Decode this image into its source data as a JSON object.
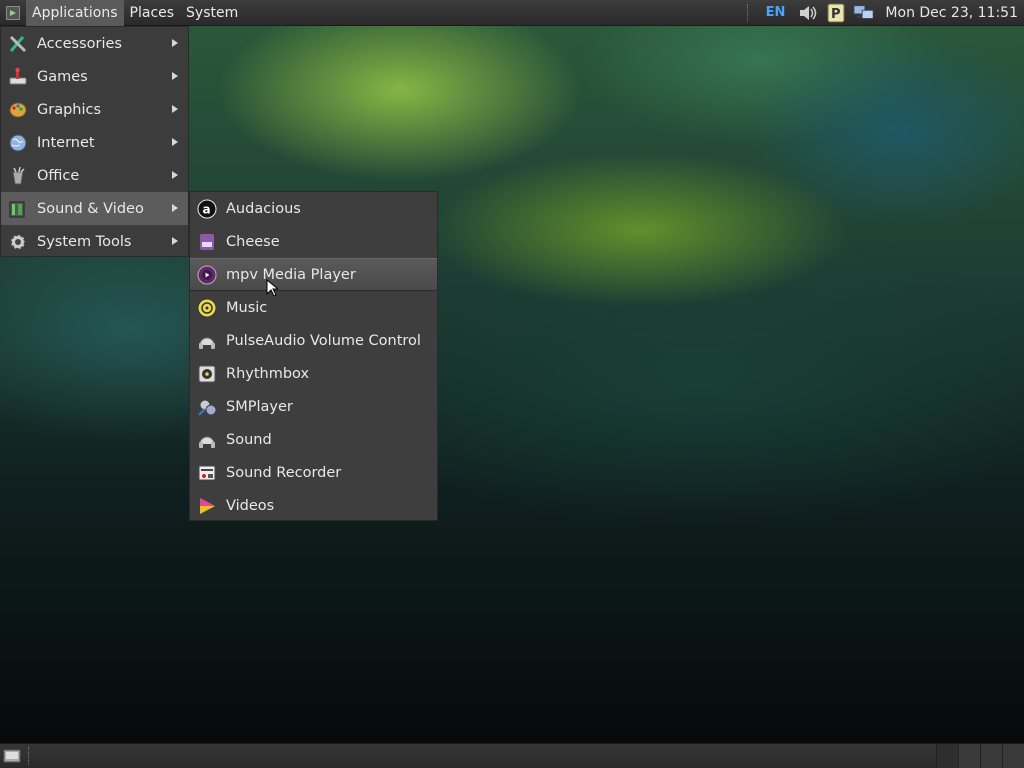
{
  "top_panel": {
    "menus": [
      "Applications",
      "Places",
      "System"
    ],
    "language": "EN",
    "clock": "Mon Dec 23, 11:51",
    "tray_icons": [
      "volume-icon",
      "clipboard-p-icon",
      "network-icon"
    ]
  },
  "main_menu": {
    "items": [
      {
        "label": "Accessories",
        "icon": "accessories-icon"
      },
      {
        "label": "Games",
        "icon": "games-icon"
      },
      {
        "label": "Graphics",
        "icon": "graphics-icon"
      },
      {
        "label": "Internet",
        "icon": "internet-icon"
      },
      {
        "label": "Office",
        "icon": "office-icon"
      },
      {
        "label": "Sound & Video",
        "icon": "sound-video-icon"
      },
      {
        "label": "System Tools",
        "icon": "system-tools-icon"
      }
    ],
    "active": "Sound & Video"
  },
  "sub_menu": {
    "items": [
      {
        "label": "Audacious",
        "icon": "audacious-icon"
      },
      {
        "label": "Cheese",
        "icon": "cheese-icon"
      },
      {
        "label": "mpv Media Player",
        "icon": "mpv-icon"
      },
      {
        "label": "Music",
        "icon": "music-icon"
      },
      {
        "label": "PulseAudio Volume Control",
        "icon": "pulseaudio-icon"
      },
      {
        "label": "Rhythmbox",
        "icon": "rhythmbox-icon"
      },
      {
        "label": "SMPlayer",
        "icon": "smplayer-icon"
      },
      {
        "label": "Sound",
        "icon": "sound-icon"
      },
      {
        "label": "Sound Recorder",
        "icon": "sound-recorder-icon"
      },
      {
        "label": "Videos",
        "icon": "videos-icon"
      }
    ],
    "hovered": "mpv Media Player"
  },
  "colors": {
    "panel": "#2e2e2e",
    "menu_bg": "#3c3c3c",
    "highlight": "#5c5c5c",
    "lang_accent": "#4aa3ff"
  }
}
